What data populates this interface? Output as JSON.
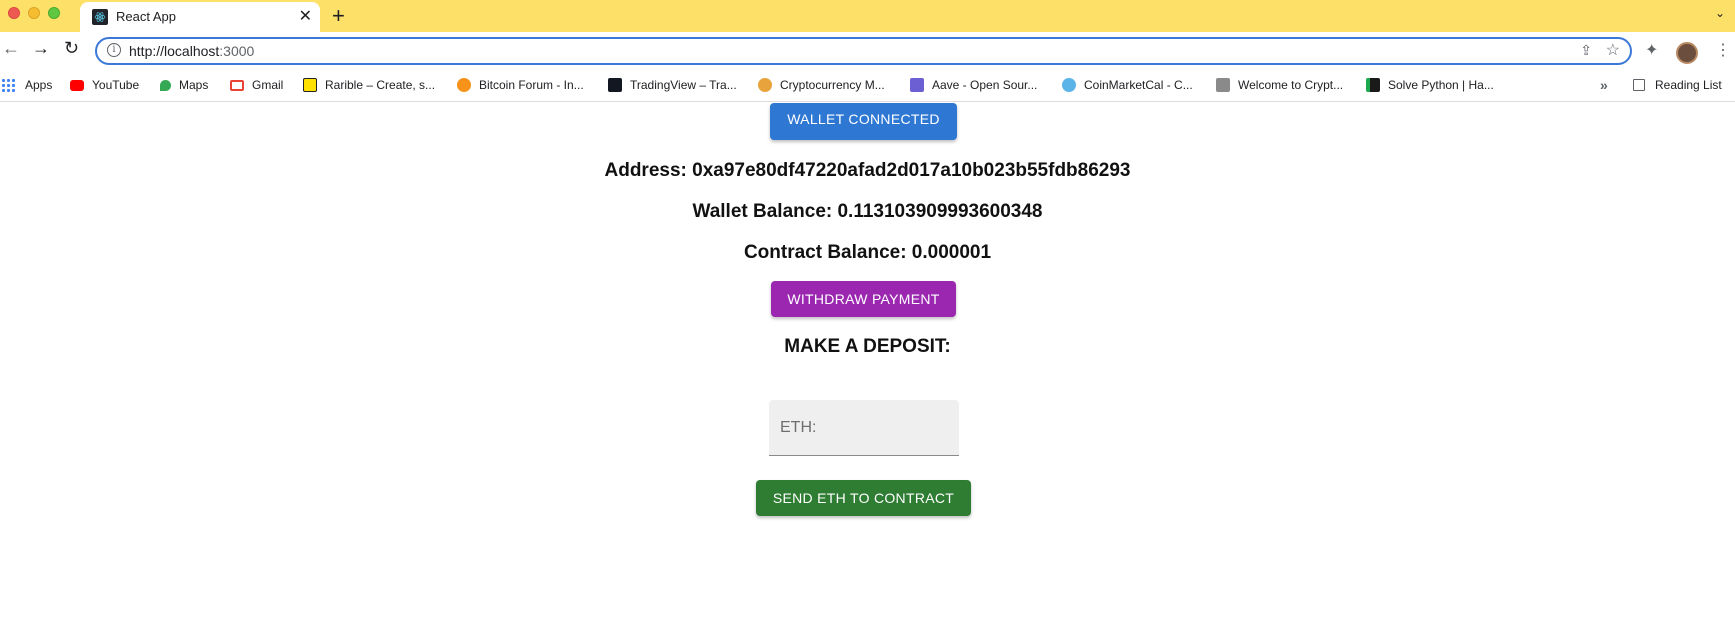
{
  "browser": {
    "tab_title": "React App",
    "url_host": "http://localhost",
    "url_port": ":3000",
    "bookmarks": [
      {
        "label": "Apps",
        "icon": "apps-grid-icon",
        "color": "#4285f4"
      },
      {
        "label": "YouTube",
        "icon": "youtube-icon",
        "color": "#ff0000"
      },
      {
        "label": "Maps",
        "icon": "maps-pin-icon",
        "color": "#34a853"
      },
      {
        "label": "Gmail",
        "icon": "gmail-icon",
        "color": "#ea4335"
      },
      {
        "label": "Rarible – Create, s...",
        "icon": "rarible-icon",
        "color": "#fee100"
      },
      {
        "label": "Bitcoin Forum - In...",
        "icon": "bitcoin-icon",
        "color": "#f7931a"
      },
      {
        "label": "TradingView – Tra...",
        "icon": "tradingview-icon",
        "color": "#131722"
      },
      {
        "label": "Cryptocurrency M...",
        "icon": "crypto-icon",
        "color": "#e8a33d"
      },
      {
        "label": "Aave - Open Sour...",
        "icon": "aave-icon",
        "color": "#6b5fd3"
      },
      {
        "label": "CoinMarketCal - C...",
        "icon": "coinmarketcal-icon",
        "color": "#5ab4e8"
      },
      {
        "label": "Welcome to Crypt...",
        "icon": "crypto-site-icon",
        "color": "#8a8a8a"
      },
      {
        "label": "Solve Python | Ha...",
        "icon": "hackerrank-icon",
        "color": "#1ba94c"
      }
    ],
    "reading_list": "Reading List"
  },
  "app": {
    "wallet_button": "WALLET CONNECTED",
    "address_text": "Address: 0xa97e80df47220afad2d017a10b023b55fdb86293",
    "wallet_balance_text": "Wallet Balance: 0.113103909993600348",
    "contract_balance_text": "Contract Balance: 0.000001",
    "withdraw_button": "WITHDRAW PAYMENT",
    "deposit_heading": "MAKE A DEPOSIT:",
    "eth_placeholder": "ETH:",
    "send_button": "SEND ETH TO CONTRACT",
    "colors": {
      "connected": "#2e78d4",
      "withdraw": "#9b27b0",
      "send": "#2e7d32",
      "tab_strip": "#fde068"
    }
  }
}
